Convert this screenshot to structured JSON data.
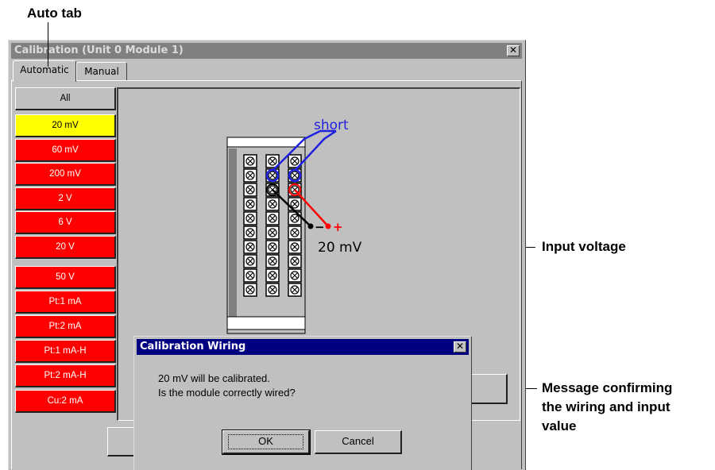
{
  "annotations": {
    "auto_tab": "Auto tab",
    "input_voltage": "Input voltage",
    "message_line1": "Message confirming",
    "message_line2": "the wiring and input",
    "message_line3": "value"
  },
  "window": {
    "title": "Calibration (Unit 0 Module 1)",
    "close_glyph": "✕"
  },
  "tabs": [
    {
      "label": "Automatic",
      "active": true
    },
    {
      "label": "Manual",
      "active": false
    }
  ],
  "ranges": [
    {
      "label": "All",
      "color": "#c0c0c0"
    },
    {
      "label": "20 mV",
      "color": "#ffff00"
    },
    {
      "label": "60 mV",
      "color": "#ff0000"
    },
    {
      "label": "200 mV",
      "color": "#ff0000"
    },
    {
      "label": "2 V",
      "color": "#ff0000"
    },
    {
      "label": "6 V",
      "color": "#ff0000"
    },
    {
      "label": "20 V",
      "color": "#ff0000"
    },
    {
      "label": "50 V",
      "color": "#ff0000"
    },
    {
      "label": "Pt:1 mA",
      "color": "#ff0000"
    },
    {
      "label": "Pt:2 mA",
      "color": "#ff0000"
    },
    {
      "label": "Pt:1 mA-H",
      "color": "#ff0000"
    },
    {
      "label": "Pt:2 mA-H",
      "color": "#ff0000"
    },
    {
      "label": "Cu:2 mA",
      "color": "#ff0000"
    }
  ],
  "wiring": {
    "short_label": "short",
    "minus": "−",
    "plus": "+",
    "voltage": "20 mV",
    "colors": {
      "short": "#2020e0",
      "positive": "#ff0000",
      "negative": "#000000"
    }
  },
  "dialog": {
    "title": "Calibration Wiring",
    "close_glyph": "✕",
    "line1": "20 mV will be calibrated.",
    "line2": "Is the module correctly wired?",
    "ok_label": "OK",
    "cancel_label": "Cancel"
  }
}
